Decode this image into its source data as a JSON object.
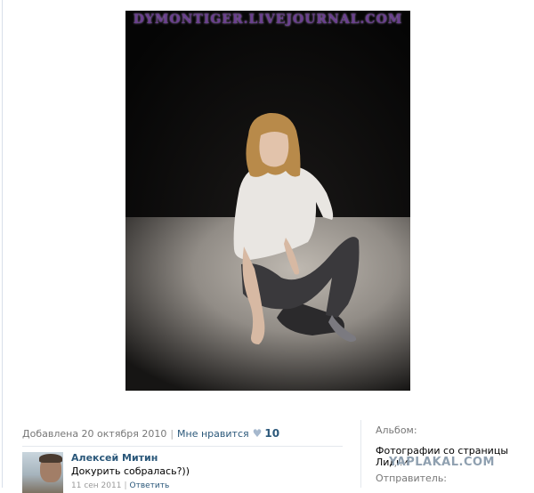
{
  "photo": {
    "watermark": "DYMONTIGER.LIVEJOURNAL.COM"
  },
  "meta": {
    "added": "Добавлена 20 октября 2010",
    "separator": "|",
    "like_label": "Мне нравится",
    "like_icon": "heart-icon",
    "like_count": "10"
  },
  "comment": {
    "author": "Алексей Митин",
    "text": "Докурить собралась?))",
    "date": "11 сен 2011",
    "separator": "|",
    "reply": "Ответить"
  },
  "sidebar": {
    "album_label": "Альбом:",
    "album_name": "Фотографии со страницы Лидии",
    "sender_label": "Отправитель:"
  },
  "brand": "YAPLAKAL.COM",
  "colors": {
    "link": "#2b587a",
    "muted": "#777777",
    "watermark": "#6a3f8f"
  }
}
